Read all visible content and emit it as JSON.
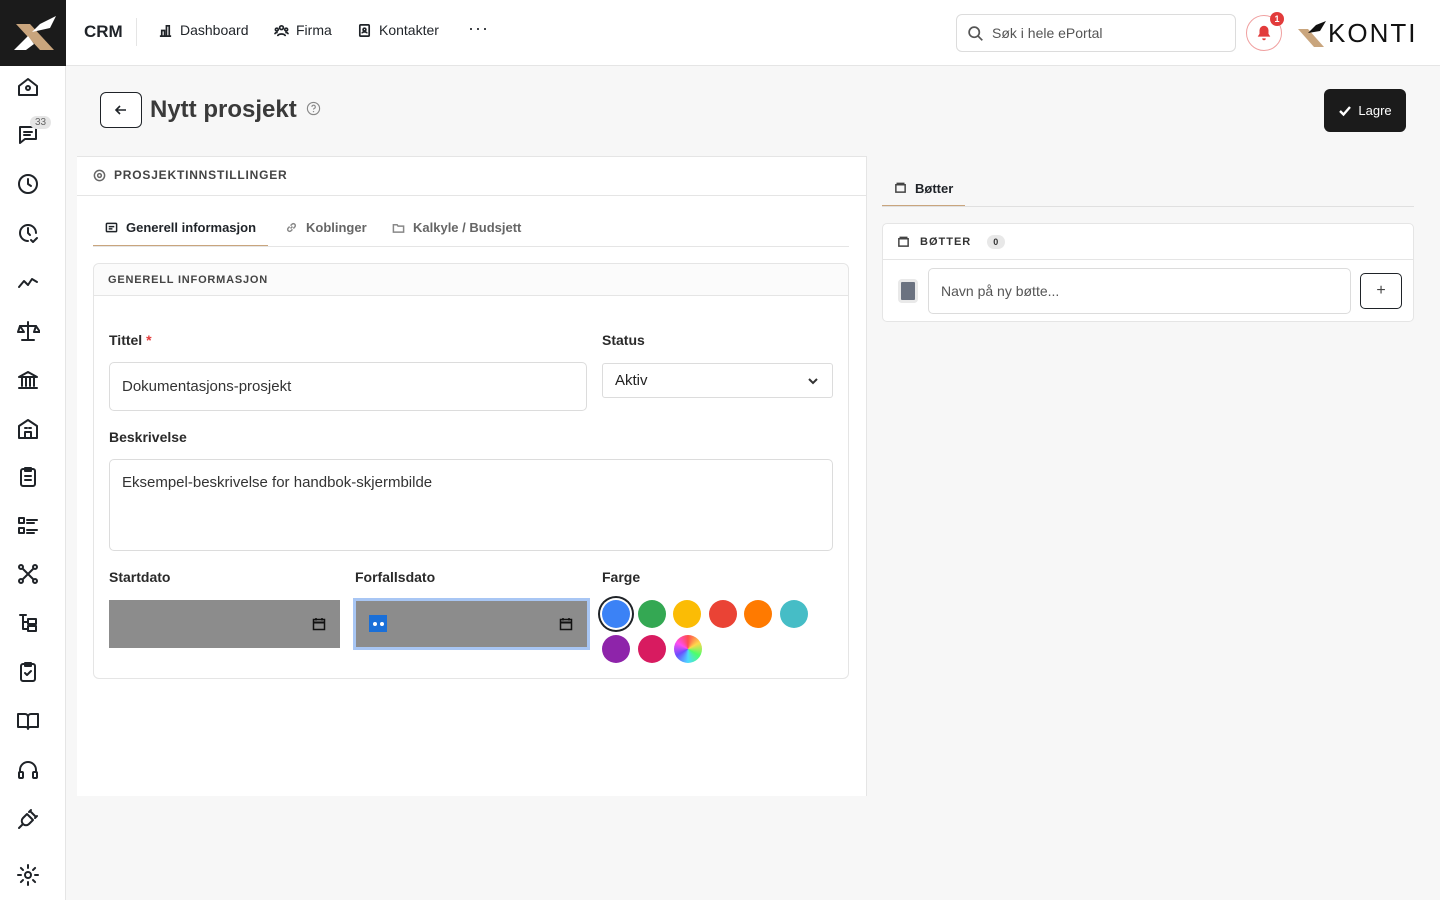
{
  "topbar": {
    "app_name": "CRM",
    "nav": [
      {
        "label": "Dashboard",
        "icon": "bar-chart-icon"
      },
      {
        "label": "Firma",
        "icon": "users-icon"
      },
      {
        "label": "Kontakter",
        "icon": "contact-book-icon"
      }
    ],
    "more_label": "···",
    "search_placeholder": "Søk i hele ePortal",
    "notification_count": "1",
    "brand_text": "KONTI"
  },
  "sidebar": {
    "badge": "33",
    "items": [
      "home-icon",
      "chat-icon",
      "clock-icon",
      "clock-check-icon",
      "trend-icon",
      "scale-icon",
      "bank-icon",
      "building-icon",
      "clipboard-list-icon",
      "list-icon",
      "network-icon",
      "tree-icon",
      "clipboard-check-icon",
      "book-icon",
      "headset-icon",
      "plug-icon",
      "gear-icon"
    ]
  },
  "page": {
    "title": "Nytt prosjekt",
    "save_label": "Lagre"
  },
  "settings": {
    "section_title": "PROSJEKTINNSTILLINGER",
    "tabs": [
      {
        "label": "Generell informasjon",
        "active": true
      },
      {
        "label": "Koblinger",
        "active": false
      },
      {
        "label": "Kalkyle / Budsjett",
        "active": false
      }
    ]
  },
  "form": {
    "card_title": "GENERELL INFORMASJON",
    "title_label": "Tittel",
    "required_mark": "*",
    "title_value": "Dokumentasjons-prosjekt",
    "status_label": "Status",
    "status_value": "Aktiv",
    "description_label": "Beskrivelse",
    "description_value": "Eksempel-beskrivelse for handbok-skjermbilde",
    "start_label": "Startdato",
    "due_label": "Forfallsdato",
    "color_label": "Farge",
    "colors": [
      "#3b82f6",
      "#34a853",
      "#fbbc05",
      "#ea4335",
      "#ff7a00",
      "#46bdc6",
      "#8e24aa",
      "#d81b60"
    ],
    "selected_color": "#3b82f6"
  },
  "buckets": {
    "tab_label": "Bøtter",
    "header": "BØTTER",
    "count": "0",
    "placeholder": "Navn på ny bøtte...",
    "add_label": "+",
    "default_color": "#6b7280"
  }
}
